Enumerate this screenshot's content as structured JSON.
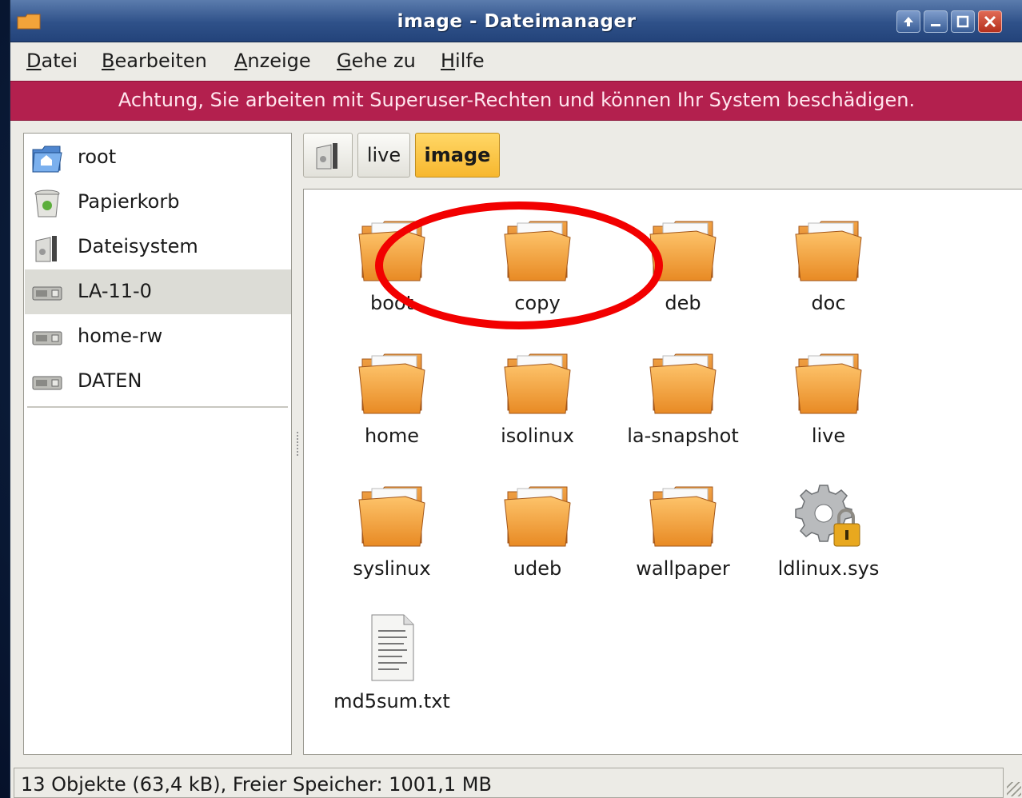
{
  "window": {
    "title": "image - Dateimanager",
    "controls": [
      "shade",
      "minimize",
      "maximize",
      "close"
    ]
  },
  "menubar": {
    "items": [
      {
        "label": "Datei",
        "mnemonic": "D",
        "rest": "atei"
      },
      {
        "label": "Bearbeiten",
        "mnemonic": "B",
        "rest": "earbeiten"
      },
      {
        "label": "Anzeige",
        "mnemonic": "A",
        "rest": "nzeige"
      },
      {
        "label": "Gehe zu",
        "mnemonic": "G",
        "rest": "ehe zu"
      },
      {
        "label": "Hilfe",
        "mnemonic": "H",
        "rest": "ilfe"
      }
    ]
  },
  "warning": {
    "text": "Achtung, Sie arbeiten mit Superuser-Rechten und können Ihr System beschädigen.",
    "color": "#b3204e"
  },
  "sidebar": {
    "items": [
      {
        "label": "root",
        "icon": "home-folder-icon"
      },
      {
        "label": "Papierkorb",
        "icon": "trash-icon"
      },
      {
        "label": "Dateisystem",
        "icon": "filesystem-icon"
      },
      {
        "label": "LA-11-0",
        "icon": "drive-icon",
        "selected": true
      },
      {
        "label": "home-rw",
        "icon": "drive-icon"
      },
      {
        "label": "DATEN",
        "icon": "drive-icon"
      }
    ]
  },
  "pathbar": {
    "items": [
      {
        "label": "",
        "icon": "filesystem-icon"
      },
      {
        "label": "live"
      },
      {
        "label": "image",
        "active": true
      }
    ]
  },
  "files": [
    {
      "name": "boot",
      "type": "folder"
    },
    {
      "name": "copy",
      "type": "folder"
    },
    {
      "name": "deb",
      "type": "folder"
    },
    {
      "name": "doc",
      "type": "folder"
    },
    {
      "name": "home",
      "type": "folder"
    },
    {
      "name": "isolinux",
      "type": "folder"
    },
    {
      "name": "la-snapshot",
      "type": "folder"
    },
    {
      "name": "live",
      "type": "folder"
    },
    {
      "name": "syslinux",
      "type": "folder"
    },
    {
      "name": "udeb",
      "type": "folder"
    },
    {
      "name": "wallpaper",
      "type": "folder"
    },
    {
      "name": "ldlinux.sys",
      "type": "locked-system-file"
    },
    {
      "name": "md5sum.txt",
      "type": "text-file"
    }
  ],
  "status": {
    "text": "13 Objekte (63,4 kB), Freier Speicher: 1001,1 MB"
  },
  "annotation": {
    "highlighted_item": "copy",
    "color": "#f20000"
  }
}
